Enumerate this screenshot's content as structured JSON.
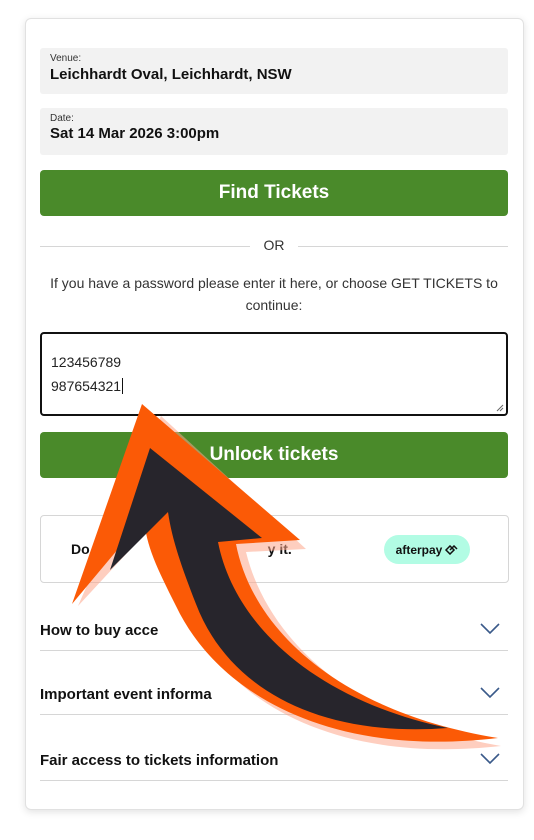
{
  "venue": {
    "label": "Venue:",
    "value": "Leichhardt Oval, Leichhardt, NSW"
  },
  "date": {
    "label": "Date:",
    "value": "Sat 14 Mar 2026 3:00pm"
  },
  "find_tickets_label": "Find Tickets",
  "or_label": "OR",
  "password_intro": "If you have a password please enter it here, or choose GET TICKETS to continue:",
  "password_field": {
    "line1": "123456789",
    "line2": "987654321"
  },
  "unlock_label": "Unlock tickets",
  "afterpay": {
    "text_start": "Do",
    "text_end": "y it.",
    "badge": "afterpay"
  },
  "accordions": [
    {
      "title": "How to buy acce"
    },
    {
      "title": "Important event informa"
    },
    {
      "title": "Fair access to tickets information"
    }
  ],
  "colors": {
    "primary_green": "#4a8a2a",
    "arrow_orange": "#fb5a06",
    "arrow_dark": "#27252c",
    "afterpay_mint": "#b2fce4"
  }
}
